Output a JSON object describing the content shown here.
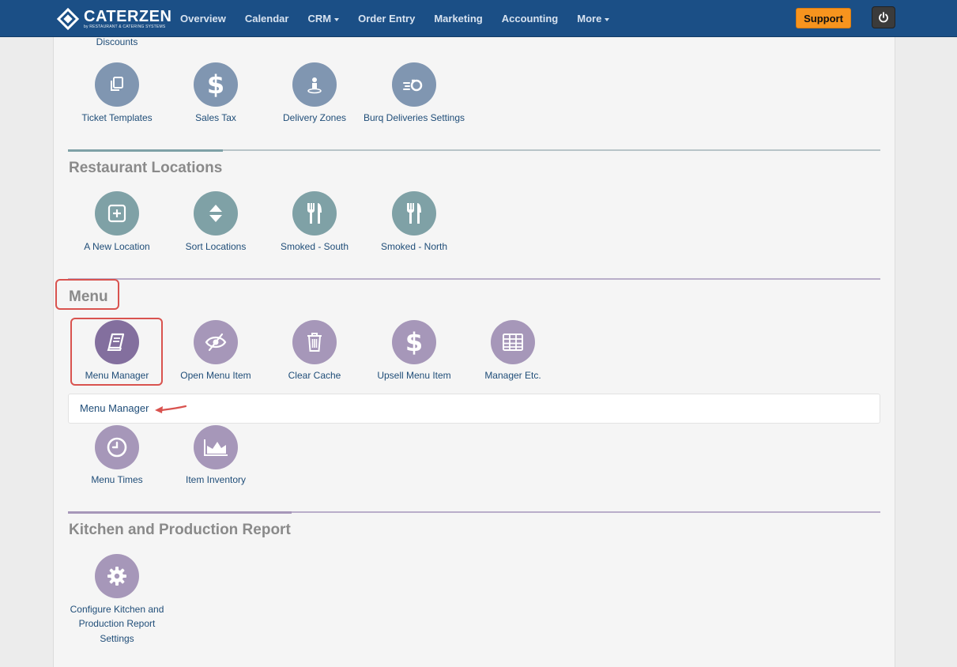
{
  "brand": {
    "name": "CATERZEN",
    "subtitle": "by RESTAURANT & CATERING SYSTEMS"
  },
  "nav": {
    "items": [
      {
        "label": "Overview",
        "dropdown": false
      },
      {
        "label": "Calendar",
        "dropdown": false
      },
      {
        "label": "CRM",
        "dropdown": true
      },
      {
        "label": "Order Entry",
        "dropdown": false
      },
      {
        "label": "Marketing",
        "dropdown": false
      },
      {
        "label": "Accounting",
        "dropdown": false
      },
      {
        "label": "More",
        "dropdown": true
      }
    ],
    "support_label": "Support",
    "power_icon": "power-icon"
  },
  "top_section": {
    "partial_label": "Discounts",
    "items": [
      {
        "label": "Ticket Templates",
        "icon": "copy-icon"
      },
      {
        "label": "Sales Tax",
        "icon": "dollar-icon"
      },
      {
        "label": "Delivery Zones",
        "icon": "location-pin-icon"
      },
      {
        "label": "Burq Deliveries Settings",
        "icon": "delivery-icon"
      }
    ]
  },
  "restaurant_locations": {
    "title": "Restaurant Locations",
    "items": [
      {
        "label": "A New Location",
        "icon": "plus-square-icon"
      },
      {
        "label": "Sort Locations",
        "icon": "sort-icon"
      },
      {
        "label": "Smoked - South",
        "icon": "utensils-icon"
      },
      {
        "label": "Smoked - North",
        "icon": "utensils-icon"
      }
    ]
  },
  "menu": {
    "title": "Menu",
    "items": [
      {
        "label": "Menu Manager",
        "icon": "book-icon"
      },
      {
        "label": "Open Menu Item",
        "icon": "eye-slash-icon"
      },
      {
        "label": "Clear Cache",
        "icon": "trash-icon"
      },
      {
        "label": "Upsell Menu Item",
        "icon": "dollar-icon"
      },
      {
        "label": "Manager Etc.",
        "icon": "table-icon"
      }
    ],
    "tooltip": "Menu Manager",
    "items_row2": [
      {
        "label": "Menu Times",
        "icon": "clock-icon"
      },
      {
        "label": "Item Inventory",
        "icon": "area-chart-icon"
      }
    ]
  },
  "kitchen": {
    "title": "Kitchen and Production Report",
    "items": [
      {
        "label_line1": "Configure Kitchen and",
        "label_line2": "Production Report",
        "label_line3": "Settings",
        "icon": "gear-icon"
      }
    ]
  },
  "colors": {
    "nav_bg": "#1b4f86",
    "support": "#f7941e",
    "highlight": "#d9534f",
    "section_blue": "#8096b1",
    "section_teal": "#7fa1a6",
    "section_purple": "#a697b9"
  }
}
